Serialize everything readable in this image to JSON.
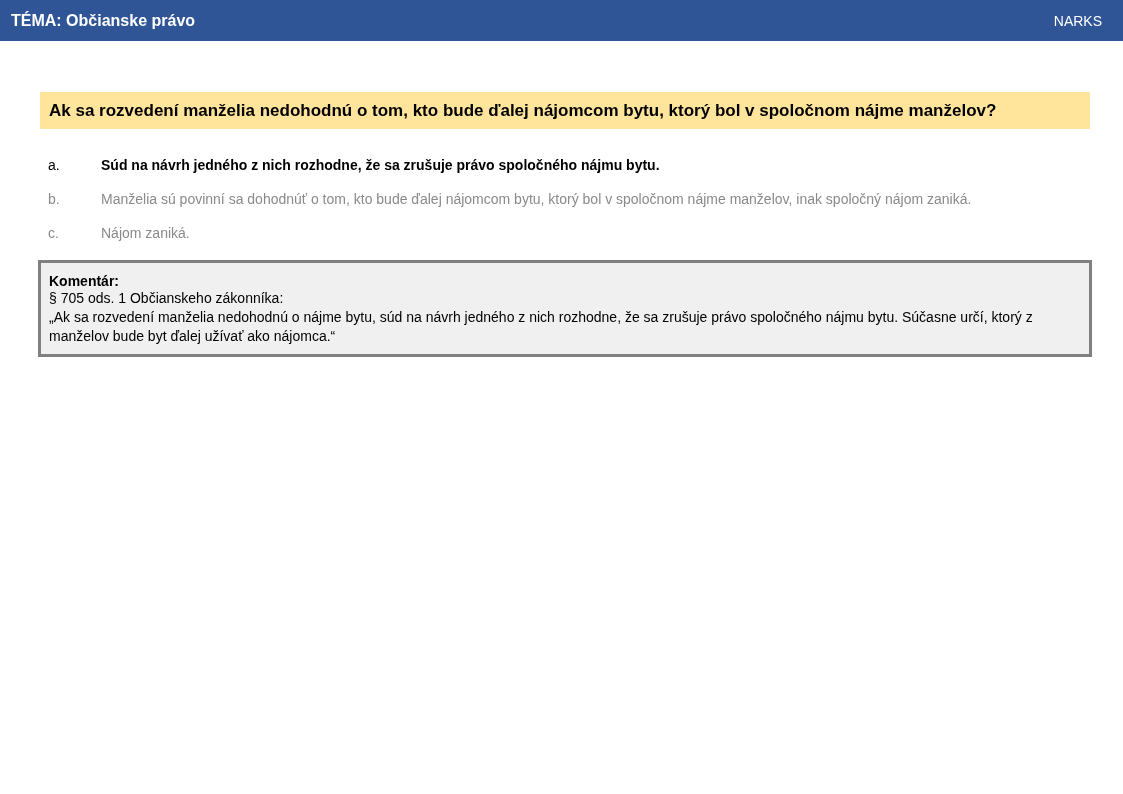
{
  "header": {
    "title": "TÉMA: Občianske právo",
    "brand": "NARKS"
  },
  "question": "Ak sa rozvedení manželia nedohodnú o tom, kto bude ďalej nájomcom bytu, ktorý bol v spoločnom nájme manželov?",
  "answers": [
    {
      "letter": "a.",
      "text": "Súd na návrh jedného z nich rozhodne, že sa zrušuje právo spoločného nájmu bytu.",
      "correct": true
    },
    {
      "letter": "b.",
      "text": "Manželia sú povinní sa dohodnúť  o tom, kto bude ďalej nájomcom bytu, ktorý bol v spoločnom nájme manželov, inak spoločný nájom zaniká.",
      "correct": false
    },
    {
      "letter": "c.",
      "text": "Nájom zaniká.",
      "correct": false
    }
  ],
  "comment": {
    "heading": "Komentár:",
    "source": "§ 705 ods. 1 Občianskeho zákonníka:",
    "quote": "„Ak sa rozvedení manželia nedohodnú o nájme bytu, súd na návrh jedného z nich rozhodne, že sa zrušuje právo spoločného nájmu bytu. Súčasne určí, ktorý z manželov bude byt ďalej užívať ako nájomca.“"
  }
}
